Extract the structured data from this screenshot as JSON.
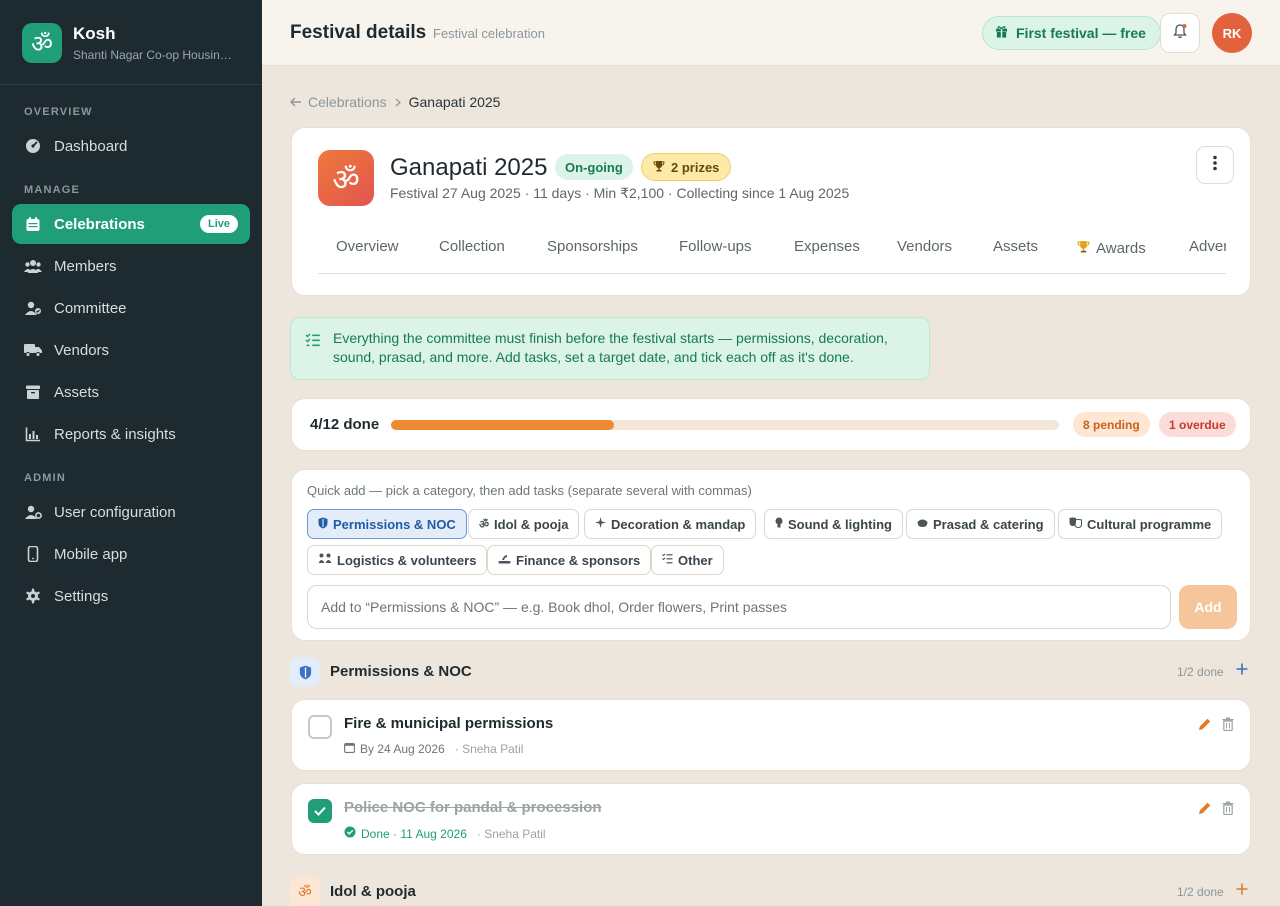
{
  "brand": {
    "logo_glyph": "ॐ",
    "name": "Kosh",
    "subtitle": "Shanti Nagar Co-op Housing Society"
  },
  "sidebar": {
    "sections": [
      "OVERVIEW",
      "MANAGE",
      "ADMIN"
    ],
    "items": [
      {
        "label": "Dashboard",
        "icon": "dashboard-icon"
      },
      {
        "label": "Celebrations",
        "icon": "calendar-icon",
        "badge": "Live",
        "active": true
      },
      {
        "label": "Members",
        "icon": "members-icon"
      },
      {
        "label": "Committee",
        "icon": "committee-icon"
      },
      {
        "label": "Vendors",
        "icon": "truck-icon"
      },
      {
        "label": "Assets",
        "icon": "archive-icon"
      },
      {
        "label": "Reports & insights",
        "icon": "chart-icon"
      },
      {
        "label": "User configuration",
        "icon": "user-cog-icon"
      },
      {
        "label": "Mobile app",
        "icon": "mobile-icon"
      },
      {
        "label": "Settings",
        "icon": "gear-icon"
      }
    ]
  },
  "header": {
    "title": "Festival details",
    "subtitle": "Festival celebration",
    "promo": "First festival — free",
    "avatar_initials": "RK"
  },
  "breadcrumb": {
    "parent": "Celebrations",
    "current": "Ganapati 2025"
  },
  "festival": {
    "logo_glyph": "ॐ",
    "name": "Ganapati 2025",
    "status": "On-going",
    "prizes": "2 prizes",
    "meta": "Festival 27 Aug 2025 · 11 days · Min ₹2,100 · Collecting since 1 Aug 2025",
    "tabs": [
      "Overview",
      "Collection",
      "Sponsorships",
      "Follow-ups",
      "Expenses",
      "Vendors",
      "Assets",
      "Awards",
      "Advertisements"
    ]
  },
  "info": {
    "text": "Everything the committee must finish before the festival starts — permissions, decoration, sound, prasad, and more. Add tasks, set a target date, and tick each off as it's done."
  },
  "progress": {
    "label": "4/12 done",
    "done": 4,
    "total": 12,
    "pending": "8 pending",
    "overdue": "1 overdue",
    "color": "#ef8a33"
  },
  "quick_add": {
    "hint": "Quick add — pick a category, then add tasks (separate several with commas)",
    "categories": [
      {
        "label": "Permissions & NOC",
        "icon": "shield-icon",
        "active": true
      },
      {
        "label": "Idol & pooja",
        "icon": "om-icon"
      },
      {
        "label": "Decoration & mandap",
        "icon": "sparkle-icon"
      },
      {
        "label": "Sound & lighting",
        "icon": "bulb-icon"
      },
      {
        "label": "Prasad & catering",
        "icon": "bowl-icon"
      },
      {
        "label": "Cultural programme",
        "icon": "masks-icon"
      },
      {
        "label": "Logistics & volunteers",
        "icon": "people-icon"
      },
      {
        "label": "Finance & sponsors",
        "icon": "coins-icon"
      },
      {
        "label": "Other",
        "icon": "list-icon"
      }
    ],
    "placeholder": "Add to “Permissions & NOC” — e.g. Book dhol, Order flowers, Print passes",
    "button": "Add"
  },
  "groups": [
    {
      "title": "Permissions & NOC",
      "count": "1/2 done",
      "icon": "shield-icon",
      "accent": "#3b72c4",
      "tasks": [
        {
          "title": "Fire & municipal permissions",
          "date": "By 24 Aug 2026",
          "assignee": "· Sneha Patil",
          "done": false
        },
        {
          "title": "Police NOC for pandal & procession",
          "date": "Done · 11 Aug 2026",
          "assignee": "· Sneha Patil",
          "done": true
        }
      ]
    },
    {
      "title": "Idol & pooja",
      "count": "1/2 done",
      "icon": "om-icon",
      "accent": "#e07a2c"
    }
  ]
}
